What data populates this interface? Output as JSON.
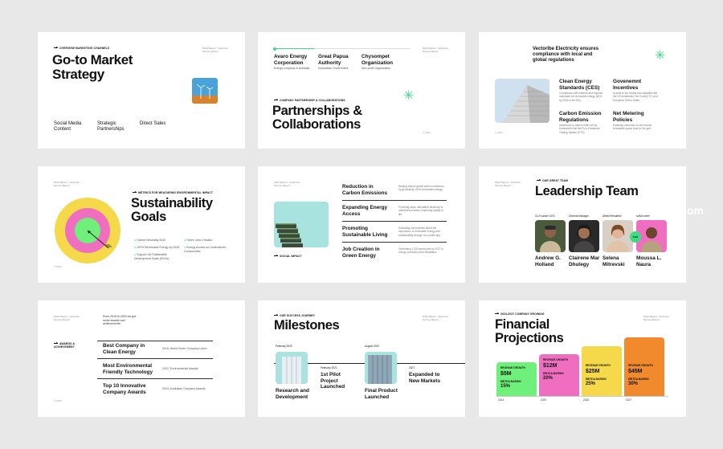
{
  "watermark": "om",
  "slides": {
    "gtm": {
      "label": "OVERVIEW MARKETING CHANNELS",
      "title_line1": "Go-to Market",
      "title_line2": "Strategy",
      "meta": "Work Report · Vectorize Service Report",
      "channels": [
        "Social Media Content",
        "Strategic Partnerships",
        "Direct Sales"
      ],
      "page": "© 2024"
    },
    "partners": {
      "items": [
        {
          "name": "Avaro Energy Corporation",
          "desc": "Energy company in Australia"
        },
        {
          "name": "Great Papua Authority",
          "desc": "Indonesian Government"
        },
        {
          "name": "Chysompet Organization",
          "desc": "Non-profit Organization"
        }
      ],
      "meta": "Work Report · Vectorize Service Report",
      "label": "COMPANY PARTNERSHIP & COLLABORATIONS",
      "title_line1": "Partnerships &",
      "title_line2": "Collaborations",
      "page": "© 2024"
    },
    "compliance": {
      "heading": "Vectorlbe Electricity ensures compliance with local and global regulations",
      "items": [
        {
          "title": "Clean Energy Standards (CES)",
          "desc": "Compliance with national and regional mandates for renewable energy (50% by 2030 in the US)."
        },
        {
          "title": "Govenemnt Incentives",
          "desc": "Access to tax credits and subsidies like the US Investment Tax Credit (ITC) and European Green Tariffs."
        },
        {
          "title": "Carbon Emission Regulations",
          "desc": "Adherence to carbon limits set by frameworks like the EU's Emissions Trading System (ETS)."
        },
        {
          "title": "Net Metering Policies",
          "desc": "Enabling customers to sell excess renewable power back to the grid."
        }
      ],
      "page": "© 2024"
    },
    "sustain": {
      "meta": "Work Report · Vectorize Service Report",
      "label": "METRICS FOR MEASURING ENVIRONMENTAL IMPACT",
      "title_line1": "Sustainability",
      "title_line2": "Goals",
      "goals": [
        "Carbon Neutrality 2030",
        "Green Jobs Creation",
        "100% Renewable Energy by 2028",
        "Energy Access for Underserved Communities",
        "Support UN Sustainable Development Goals (SDGs)"
      ],
      "page": "© 2024"
    },
    "impact": {
      "meta": "Work Report · Vectorize Service Report",
      "label": "SOCIAL IMPACT",
      "rows": [
        {
          "title": "Reduction in Carbon Emissions",
          "desc": "Helping reduce global carbon emissions by generating 100% renewable energy."
        },
        {
          "title": "Expanding Energy Access",
          "desc": "Providing clean, affordable electricity to underserved areas, improving quality of life."
        },
        {
          "title": "Promoting Sustainable Living",
          "desc": "Educating communities about the importance of renewable energy and sustainability through our mobile app."
        },
        {
          "title": "Job Creation in Green Energy",
          "desc": "Generating 1,000 green jobs by 2027 in energy production and installation."
        }
      ]
    },
    "leadership": {
      "meta": "Work Report · Vectorize Service Report",
      "label": "OUR GREAT TEAM",
      "title": "Leadership Team",
      "roles": [
        "Co-Founder CEO",
        "General Manager",
        "Alfred Renaldino",
        "sofian ranel"
      ],
      "names": [
        {
          "first": "Andrew G.",
          "last": "Holland"
        },
        {
          "first": "Clairene Mar",
          "last": "Dhulegy"
        },
        {
          "first": "Selena",
          "last": "Mitrevski"
        },
        {
          "first": "Moussa L.",
          "last": "Naura"
        }
      ],
      "badge": "CEO"
    },
    "awards": {
      "meta": "Work Report · Vectorize Service Report",
      "intro": "From 2018 to 2023 we got some awards and achievements.",
      "label": "AWARDS & ACHIEVEMENT",
      "rows": [
        {
          "title": "Best Company in Clean Energy",
          "desc": "2018, World Green Company Union"
        },
        {
          "title": "Most Environmental Friendly Technology",
          "desc": "2022, Environmental Awards"
        },
        {
          "title": "Top 10 Innovative Company Awards",
          "desc": "2023, Australian Company Awards"
        }
      ],
      "page": "© 2024"
    },
    "milestones": {
      "label": "OUR SUCCESS JOURNEY",
      "title": "Milestones",
      "meta": "Work Report · Vectorize Service Report",
      "events": [
        {
          "date": "February 2020",
          "title": "Research and Development"
        },
        {
          "date": "February 2021",
          "title": "1st Pilot Project Launched"
        },
        {
          "date": "August 2023",
          "title": "Final Product Launched"
        },
        {
          "date": "2027",
          "title": "Expanded to New Markets"
        }
      ]
    },
    "financial": {
      "label": "2024-2027 COMPANY GROWING",
      "title_line1": "Financial",
      "title_line2": "Projections",
      "meta": "Work Report · Vectorize Service Report",
      "growth_label": "REVENUE GROWTH",
      "margin_label": "EBITDA MARGIN",
      "cards": [
        {
          "year": "2024",
          "revenue": "$5M",
          "margin": "15%",
          "color": "#6ef07a"
        },
        {
          "year": "2025",
          "revenue": "$12M",
          "margin": "20%",
          "color": "#f06ec0"
        },
        {
          "year": "2026",
          "revenue": "$25M",
          "margin": "25%",
          "color": "#f5d94a"
        },
        {
          "year": "2027",
          "revenue": "$45M",
          "margin": "30%",
          "color": "#f08a2c"
        }
      ]
    }
  }
}
